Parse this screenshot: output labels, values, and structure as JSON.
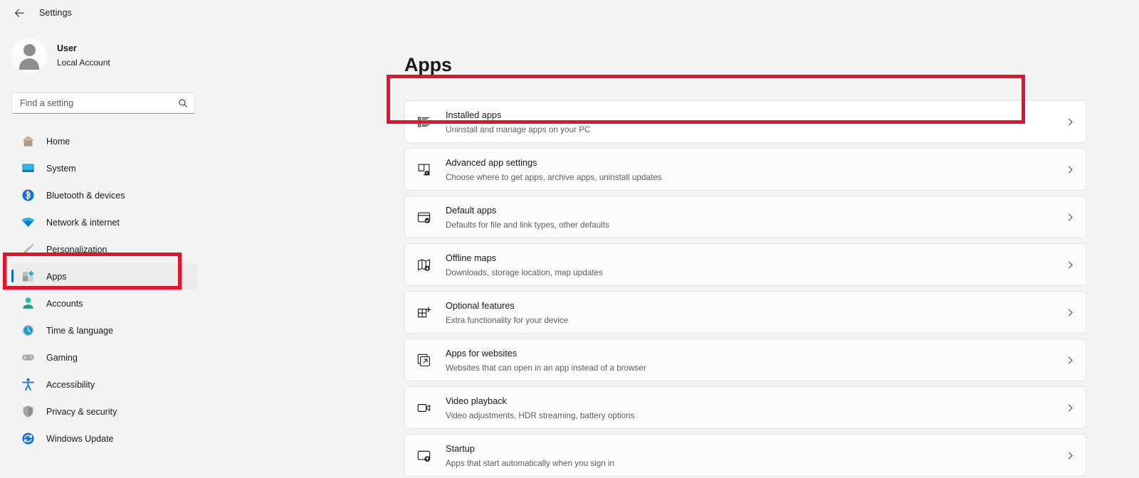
{
  "titlebar": {
    "back_icon": "back-arrow-icon",
    "title": "Settings"
  },
  "sidebar": {
    "account": {
      "avatar_icon": "user-avatar-icon",
      "name": "User",
      "subtitle": "Local Account"
    },
    "search": {
      "placeholder": "Find a setting",
      "value": "",
      "icon": "search-icon"
    },
    "items": [
      {
        "label": "Home",
        "icon": "home-icon",
        "selected": false
      },
      {
        "label": "System",
        "icon": "system-icon",
        "selected": false
      },
      {
        "label": "Bluetooth & devices",
        "icon": "bluetooth-icon",
        "selected": false
      },
      {
        "label": "Network & internet",
        "icon": "network-icon",
        "selected": false
      },
      {
        "label": "Personalization",
        "icon": "personalization-icon",
        "selected": false
      },
      {
        "label": "Apps",
        "icon": "apps-icon",
        "selected": true
      },
      {
        "label": "Accounts",
        "icon": "accounts-icon",
        "selected": false
      },
      {
        "label": "Time & language",
        "icon": "time-language-icon",
        "selected": false
      },
      {
        "label": "Gaming",
        "icon": "gaming-icon",
        "selected": false
      },
      {
        "label": "Accessibility",
        "icon": "accessibility-icon",
        "selected": false
      },
      {
        "label": "Privacy & security",
        "icon": "privacy-security-icon",
        "selected": false
      },
      {
        "label": "Windows Update",
        "icon": "windows-update-icon",
        "selected": false
      }
    ]
  },
  "main": {
    "page_title": "Apps",
    "cards": [
      {
        "title": "Installed apps",
        "subtitle": "Uninstall and manage apps on your PC",
        "icon": "installed-apps-icon",
        "chevron": "chevron-right-icon",
        "highlighted": true
      },
      {
        "title": "Advanced app settings",
        "subtitle": "Choose where to get apps, archive apps, uninstall updates",
        "icon": "advanced-app-settings-icon",
        "chevron": "chevron-right-icon",
        "highlighted": false
      },
      {
        "title": "Default apps",
        "subtitle": "Defaults for file and link types, other defaults",
        "icon": "default-apps-icon",
        "chevron": "chevron-right-icon",
        "highlighted": false
      },
      {
        "title": "Offline maps",
        "subtitle": "Downloads, storage location, map updates",
        "icon": "offline-maps-icon",
        "chevron": "chevron-right-icon",
        "highlighted": false
      },
      {
        "title": "Optional features",
        "subtitle": "Extra functionality for your device",
        "icon": "optional-features-icon",
        "chevron": "chevron-right-icon",
        "highlighted": false
      },
      {
        "title": "Apps for websites",
        "subtitle": "Websites that can open in an app instead of a browser",
        "icon": "apps-for-websites-icon",
        "chevron": "chevron-right-icon",
        "highlighted": false
      },
      {
        "title": "Video playback",
        "subtitle": "Video adjustments, HDR streaming, battery options",
        "icon": "video-playback-icon",
        "chevron": "chevron-right-icon",
        "highlighted": false
      },
      {
        "title": "Startup",
        "subtitle": "Apps that start automatically when you sign in",
        "icon": "startup-icon",
        "chevron": "chevron-right-icon",
        "highlighted": false
      }
    ]
  },
  "annotations": [
    {
      "name": "highlight-installed-apps",
      "color": "#e8112d"
    },
    {
      "name": "highlight-sidebar-apps",
      "color": "#e8112d"
    }
  ],
  "colors": {
    "page_background": "#f3f3f3",
    "card_background": "#fbfbfb",
    "card_active_background": "#ffffff",
    "accent": "#0f6cbd",
    "annotation": "#e8112d"
  }
}
